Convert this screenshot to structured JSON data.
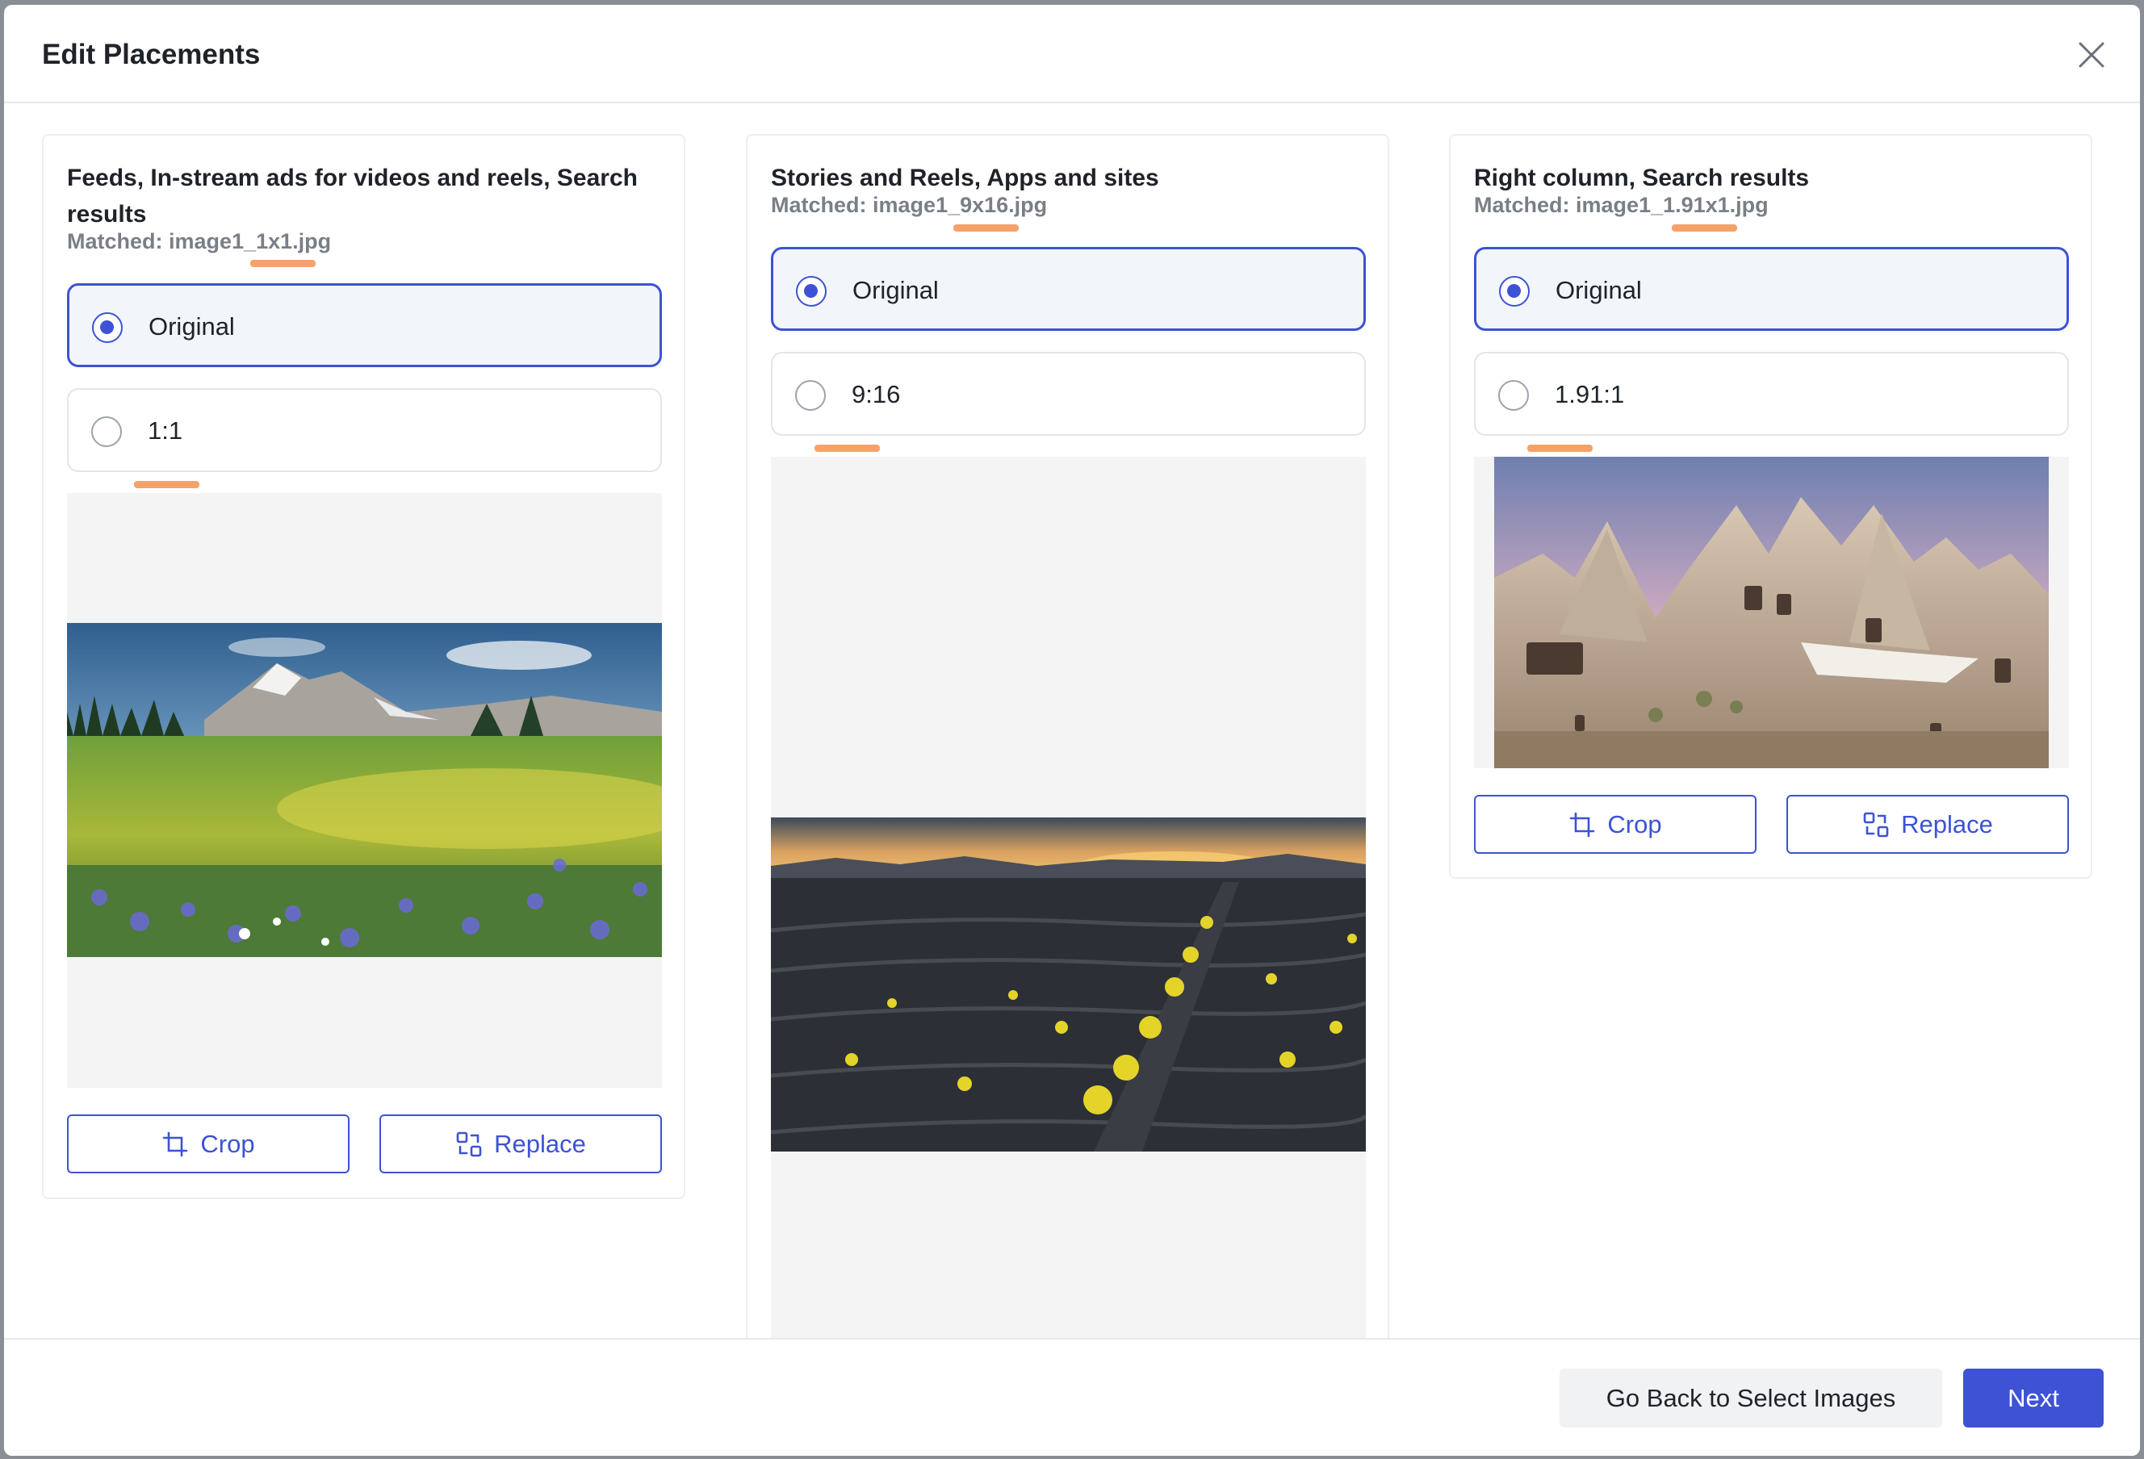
{
  "dialog": {
    "title": "Edit Placements",
    "close_icon": "close-icon"
  },
  "columns": [
    {
      "title": "Feeds, In-stream ads for videos and reels, Search results",
      "matched_label": "Matched:",
      "matched_file": "image1_1x1.jpg",
      "options": [
        {
          "label": "Original",
          "selected": true
        },
        {
          "label": "1:1",
          "selected": false
        }
      ],
      "crop_label": "Crop",
      "replace_label": "Replace",
      "image": "mountain-wildflower-meadow"
    },
    {
      "title": "Stories and Reels, Apps and sites",
      "matched_label": "Matched:",
      "matched_file": "image1_9x16.jpg",
      "options": [
        {
          "label": "Original",
          "selected": true
        },
        {
          "label": "9:16",
          "selected": false
        }
      ],
      "image": "volcanic-vineyard-sunset"
    },
    {
      "title": "Right column, Search results",
      "matched_label": "Matched:",
      "matched_file": "image1_1.91x1.jpg",
      "options": [
        {
          "label": "Original",
          "selected": true
        },
        {
          "label": "1.91:1",
          "selected": false
        }
      ],
      "crop_label": "Crop",
      "replace_label": "Replace",
      "image": "cappadocia-rock-dwellings"
    }
  ],
  "footer": {
    "back_label": "Go Back to Select Images",
    "next_label": "Next"
  },
  "colors": {
    "accent": "#3d52d5",
    "highlight_marker": "#f5a26a",
    "selected_bg": "#f2f6fb"
  }
}
